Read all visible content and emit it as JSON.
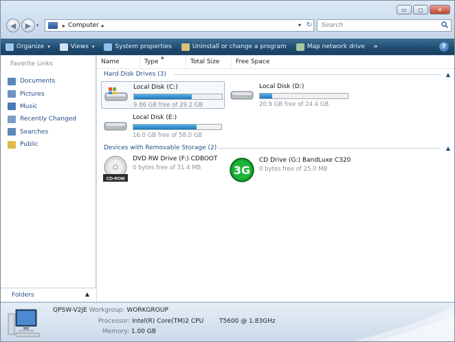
{
  "window": {
    "controls": {
      "minimize": "▭",
      "maximize": "▢",
      "close": "✕"
    }
  },
  "address_bar": {
    "crumb_sep": "▸",
    "location": "Computer",
    "after_sep": "▸",
    "dropdown": "▾",
    "refresh": "↻"
  },
  "search": {
    "placeholder": "Search"
  },
  "toolbar": {
    "items": [
      {
        "label": "Organize",
        "has_dropdown": true,
        "icon": "organize-icon",
        "color": "#9ec7ee"
      },
      {
        "label": "Views",
        "has_dropdown": true,
        "icon": "views-icon",
        "color": "#cfe3f5"
      },
      {
        "label": "System properties",
        "has_dropdown": false,
        "icon": "system-properties-icon",
        "color": "#8fc1f0"
      },
      {
        "label": "Uninstall or change a program",
        "has_dropdown": false,
        "icon": "uninstall-icon",
        "color": "#d7c27a"
      },
      {
        "label": "Map network drive",
        "has_dropdown": false,
        "icon": "map-network-drive-icon",
        "color": "#a3c9a0"
      }
    ],
    "more": "»",
    "help": "?"
  },
  "sidebar": {
    "title": "Favorite Links",
    "items": [
      {
        "label": "Documents",
        "icon": "documents-icon",
        "color": "#5d86b8"
      },
      {
        "label": "Pictures",
        "icon": "pictures-icon",
        "color": "#6f93c0"
      },
      {
        "label": "Music",
        "icon": "music-icon",
        "color": "#4a7ab5"
      },
      {
        "label": "Recently Changed",
        "icon": "recently-changed-icon",
        "color": "#7c9cc4"
      },
      {
        "label": "Searches",
        "icon": "searches-icon",
        "color": "#5d86b8"
      },
      {
        "label": "Public",
        "icon": "public-icon",
        "color": "#e0b94a"
      }
    ],
    "folders_label": "Folders",
    "folders_chevron": "▲"
  },
  "columns": {
    "name": "Name",
    "type": "Type",
    "total_size": "Total Size",
    "free_space": "Free Space"
  },
  "groups": {
    "hard_disks": {
      "title": "Hard Disk Drives (3)",
      "chevron": "▲",
      "drives": [
        {
          "name": "Local Disk (C:)",
          "free_text": "9.86 GB free of 29.2 GB",
          "used_fraction": 0.66,
          "icon": "system-drive-icon"
        },
        {
          "name": "Local Disk (D:)",
          "free_text": "20.9 GB free of 24.4 GB",
          "used_fraction": 0.14,
          "icon": "hard-drive-icon"
        },
        {
          "name": "Local Disk (E:)",
          "free_text": "16.0 GB free of 58.0 GB",
          "used_fraction": 0.72,
          "icon": "hard-drive-icon"
        }
      ]
    },
    "removable": {
      "title": "Devices with Removable Storage (2)",
      "chevron": "▲",
      "drives": [
        {
          "name": "DVD RW Drive (F:) CDBOOT",
          "free_text": "0 bytes free of 31.4 MB",
          "icon": "cd-rom-icon",
          "icon_label": "CD-ROM"
        },
        {
          "name": "CD Drive (G:) BandLuxe C320",
          "free_text": "0 bytes free of 25.0 MB",
          "icon": "3g-icon",
          "icon_label": "3G"
        }
      ]
    }
  },
  "details": {
    "computer_name": "QPSW-V2JE",
    "workgroup_label": "Workgroup:",
    "workgroup": "WORKGROUP",
    "processor_label": "Processor:",
    "processor": "Intel(R) Core(TM)2 CPU",
    "processor_speed": "T5600  @ 1.83GHz",
    "memory_label": "Memory:",
    "memory": "1.00 GB"
  }
}
